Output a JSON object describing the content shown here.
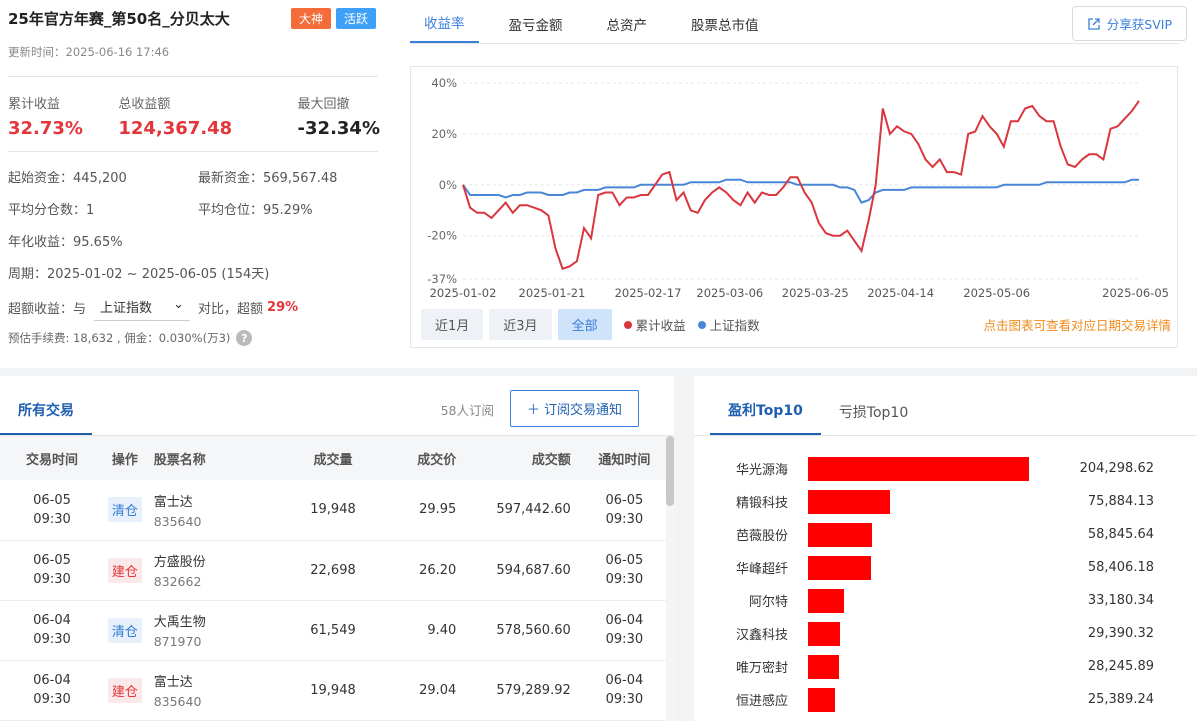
{
  "header": {
    "title": "25年官方年赛_第50名_分贝太大",
    "badges": [
      "大神",
      "活跃"
    ],
    "update_time": "更新时间：2025-06-16 17:46"
  },
  "kpis": [
    {
      "label": "累计收益",
      "value": "32.73%"
    },
    {
      "label": "总收益额",
      "value": "124,367.48"
    },
    {
      "label": "最大回撤",
      "value": "-32.34%"
    }
  ],
  "info": {
    "start_capital": "起始资金：445,200",
    "latest_capital": "最新资金：569,567.48",
    "avg_score": "平均分仓数：1",
    "avg_position": "平均仓位：95.29%",
    "annual": "年化收益：95.65%",
    "period": "周期：2025-01-02 ~ 2025-06-05 (154天)"
  },
  "excess": {
    "prefix": "超额收益：与",
    "select_value": "上证指数",
    "middle": "对比，超额",
    "value": "29%"
  },
  "fees": "预估手续费: 18,632 , 佣金：0.030%(万3)",
  "chart_tabs": [
    "收益率",
    "盈亏金额",
    "总资产",
    "股票总市值"
  ],
  "share_button": "分享获SVIP",
  "range_buttons": [
    "近1月",
    "近3月",
    "全部"
  ],
  "legend": [
    {
      "name": "累计收益",
      "color": "#d9363e"
    },
    {
      "name": "上证指数",
      "color": "#4a86d6"
    }
  ],
  "chart_hint": "点击图表可查看对应日期交易详情",
  "chart_data": {
    "type": "line",
    "y_ticks": [
      "40%",
      "20%",
      "0%",
      "-20%",
      "-37%"
    ],
    "ylim": [
      -37,
      40
    ],
    "x_ticks": [
      "2025-01-02",
      "2025-01-21",
      "2025-02-17",
      "2025-03-06",
      "2025-03-25",
      "2025-04-14",
      "2025-05-06",
      "2025-06-05"
    ],
    "series": [
      {
        "name": "累计收益",
        "color": "#d9363e",
        "values": [
          0,
          -9,
          -11,
          -11,
          -13,
          -10,
          -7,
          -11,
          -8,
          -8,
          -9,
          -10,
          -12,
          -25,
          -33,
          -32,
          -30,
          -17,
          -21,
          -4,
          -3,
          -3,
          -8,
          -5,
          -5,
          -4,
          -4,
          0,
          4,
          5,
          -6,
          -3,
          -10,
          -11,
          -6,
          -3,
          -1,
          -3,
          -6,
          -8,
          -3,
          -7,
          -3,
          -4,
          -4,
          -1,
          3,
          3,
          -3,
          -7,
          -15,
          -19,
          -20,
          -20,
          -18,
          -22,
          -26,
          -14,
          0,
          30,
          20,
          23,
          21,
          20,
          16,
          10,
          7,
          10,
          5,
          5,
          4,
          20,
          21,
          27,
          23,
          20,
          15,
          25,
          25,
          30,
          31,
          27,
          25,
          25,
          15,
          8,
          7,
          10,
          12,
          12,
          10,
          22,
          23,
          26,
          29,
          33
        ]
      },
      {
        "name": "上证指数",
        "color": "#4a86d6",
        "values": [
          0,
          -4,
          -4,
          -4,
          -4,
          -4,
          -5,
          -4,
          -4,
          -3,
          -3,
          -3,
          -4,
          -4,
          -4,
          -3,
          -3,
          -2,
          -2,
          -2,
          -1,
          -1,
          -1,
          -1,
          -1,
          0,
          0,
          0,
          0,
          0,
          0,
          0,
          1,
          1,
          1,
          1,
          1,
          2,
          2,
          2,
          1,
          1,
          1,
          1,
          1,
          1,
          1,
          0,
          0,
          0,
          0,
          0,
          0,
          -1,
          -1,
          -2,
          -7,
          -6,
          -3,
          -2,
          -2,
          -2,
          -2,
          -1,
          -1,
          -1,
          -1,
          -1,
          -1,
          -1,
          -1,
          -1,
          -1,
          -1,
          -1,
          -1,
          0,
          0,
          0,
          0,
          0,
          0,
          1,
          1,
          1,
          1,
          1,
          1,
          1,
          1,
          1,
          1,
          1,
          1,
          2,
          2
        ]
      }
    ]
  },
  "trades": {
    "tabs": [
      "所有交易"
    ],
    "subscriber_count": "58人订阅",
    "subscribe_button": "＋ 订阅交易通知",
    "columns": [
      "交易时间",
      "操作",
      "股票名称",
      "成交量",
      "成交价",
      "成交额",
      "通知时间"
    ],
    "rows": [
      {
        "date": "06-05",
        "time": "09:30",
        "op": "清仓",
        "op_type": "clear",
        "name": "富士达",
        "code": "835640",
        "volume": "19,948",
        "price": "29.95",
        "amount": "597,442.60",
        "n_date": "06-05",
        "n_time": "09:30"
      },
      {
        "date": "06-05",
        "time": "09:30",
        "op": "建仓",
        "op_type": "build",
        "name": "方盛股份",
        "code": "832662",
        "volume": "22,698",
        "price": "26.20",
        "amount": "594,687.60",
        "n_date": "06-05",
        "n_time": "09:30"
      },
      {
        "date": "06-04",
        "time": "09:30",
        "op": "清仓",
        "op_type": "clear",
        "name": "大禹生物",
        "code": "871970",
        "volume": "61,549",
        "price": "9.40",
        "amount": "578,560.60",
        "n_date": "06-04",
        "n_time": "09:30"
      },
      {
        "date": "06-04",
        "time": "09:30",
        "op": "建仓",
        "op_type": "build",
        "name": "富士达",
        "code": "835640",
        "volume": "19,948",
        "price": "29.04",
        "amount": "579,289.92",
        "n_date": "06-04",
        "n_time": "09:30"
      }
    ]
  },
  "top10": {
    "tabs": [
      "盈利Top10",
      "亏损Top10"
    ],
    "max": 204298.62,
    "items": [
      {
        "name": "华光源海",
        "value": 204298.62,
        "label": "204,298.62"
      },
      {
        "name": "精锻科技",
        "value": 75884.13,
        "label": "75,884.13"
      },
      {
        "name": "芭薇股份",
        "value": 58845.64,
        "label": "58,845.64"
      },
      {
        "name": "华峰超纤",
        "value": 58406.18,
        "label": "58,406.18"
      },
      {
        "name": "阿尔特",
        "value": 33180.34,
        "label": "33,180.34"
      },
      {
        "name": "汉鑫科技",
        "value": 29390.32,
        "label": "29,390.32"
      },
      {
        "name": "唯万密封",
        "value": 28245.89,
        "label": "28,245.89"
      },
      {
        "name": "恒进感应",
        "value": 25389.24,
        "label": "25,389.24"
      }
    ]
  }
}
